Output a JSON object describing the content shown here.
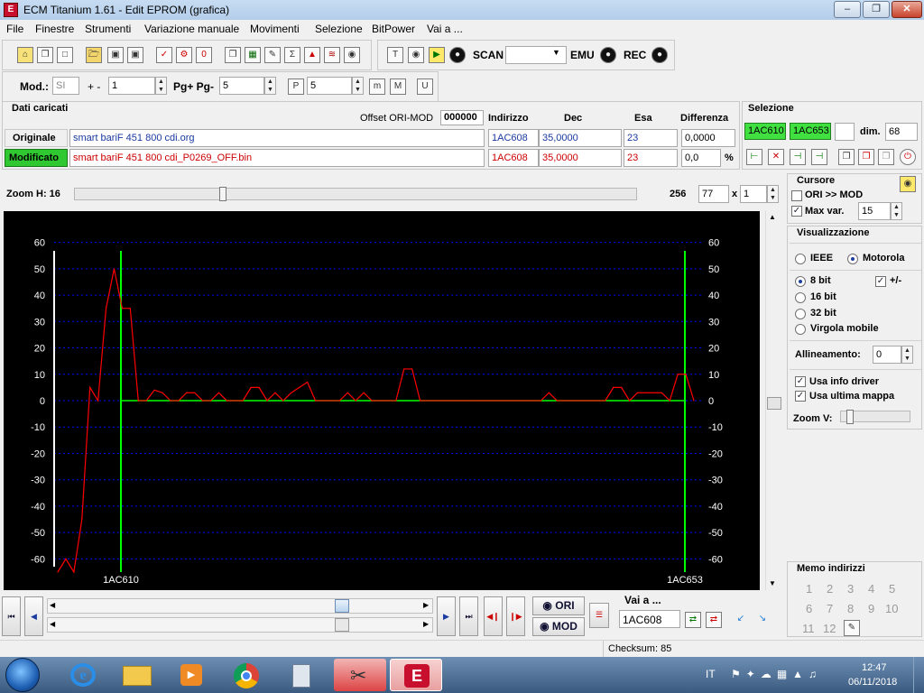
{
  "window": {
    "title": "ECM Titanium 1.61 - Edit EPROM (grafica)",
    "app_icon_letter": "E"
  },
  "menu": [
    "File",
    "Finestre",
    "Strumenti",
    "Variazione manuale",
    "Movimenti",
    "Selezione",
    "BitPower",
    "Vai a ..."
  ],
  "toolbar1": {
    "scan_label": "SCAN",
    "emu_label": "EMU",
    "rec_label": "REC",
    "scan_value": ""
  },
  "toolbar2": {
    "mod_label": "Mod.:",
    "mod_value": "SI",
    "plusminus_label": "+ -",
    "plusminus_value": "1",
    "pg_label": "Pg+ Pg-",
    "pg_value": "5",
    "p_value": "5"
  },
  "dati": {
    "title": "Dati caricati",
    "offset_label": "Offset ORI-MOD",
    "offset_value": "000000",
    "headers": {
      "indirizzo": "Indirizzo",
      "dec": "Dec",
      "esa": "Esa",
      "differenza": "Differenza"
    },
    "originale": {
      "label": "Originale",
      "file": "smart bariF 451 800 cdi.org",
      "indirizzo": "1AC608",
      "dec": "35,0000",
      "esa": "23",
      "differenza": "0,0000"
    },
    "modificato": {
      "label": "Modificato",
      "file": "smart bariF 451 800 cdi_P0269_OFF.bin",
      "indirizzo": "1AC608",
      "dec": "35,0000",
      "esa": "23",
      "differenza": "0,0",
      "percent": "%"
    }
  },
  "selezione": {
    "title": "Selezione",
    "start": "1AC610",
    "end": "1AC653",
    "dim_label": "dim.",
    "dim_value": "68"
  },
  "zoom": {
    "label": "Zoom H: 16",
    "value_256": "256",
    "value": "77",
    "x_label": "x",
    "x_value": "1",
    "slider_fraction": 0.26
  },
  "cursore": {
    "title": "Cursore",
    "ori_mod_label": "ORI >> MOD",
    "ori_mod_checked": false,
    "max_var_label": "Max var.",
    "max_var_checked": true,
    "max_var_value": "15"
  },
  "visualizzazione": {
    "title": "Visualizzazione",
    "ieee": "IEEE",
    "motorola": "Motorola",
    "selected_endian": "Motorola",
    "bit8": "8 bit",
    "bit16": "16 bit",
    "bit32": "32 bit",
    "virgola": "Virgola mobile",
    "selected_bits": "8 bit",
    "plusminus_label": "+/-",
    "plusminus_checked": true,
    "allineamento_label": "Allineamento:",
    "allineamento_value": "0",
    "usa_info_driver": "Usa info driver",
    "usa_ultima_mappa": "Usa ultima mappa",
    "zoomv_label": "Zoom V:"
  },
  "memo": {
    "title": "Memo indirizzi",
    "numbers": [
      "1",
      "2",
      "3",
      "4",
      "5",
      "6",
      "7",
      "8",
      "9",
      "10",
      "11",
      "12"
    ]
  },
  "bottom": {
    "ori_label": "ORI",
    "mod_label": "MOD",
    "vai_label": "Vai a ...",
    "vai_value": "1AC608",
    "checksum": "Checksum: 85",
    "hscroll_fraction": 0.8
  },
  "taskbar": {
    "lang": "IT",
    "time": "12:47",
    "date": "06/11/2018"
  },
  "colors": {
    "ori_line": "#ff0000",
    "mod_line": "#ff0000",
    "zero_line": "#00ff00",
    "marker": "#00ff00",
    "grid": "#0000ff",
    "green_box": "#40e040"
  },
  "chart_data": {
    "type": "line",
    "ylim": [
      -65,
      65
    ],
    "yticks": [
      60,
      50,
      40,
      30,
      20,
      10,
      0,
      -10,
      -20,
      -30,
      -40,
      -50,
      -60
    ],
    "marker_start": "1AC610",
    "marker_end": "1AC653",
    "x_range": [
      -15,
      77
    ],
    "series": [
      {
        "values": [
          -65,
          -60,
          -65,
          -45,
          5,
          0,
          35,
          50,
          35,
          35,
          0,
          0,
          4,
          3,
          0,
          0,
          3,
          3,
          0,
          0,
          3,
          0,
          0,
          0,
          5,
          5,
          0,
          3,
          0,
          3,
          5,
          7,
          0,
          0,
          0,
          0,
          3,
          0,
          3,
          0,
          0,
          0,
          0,
          12,
          12,
          0,
          0,
          0,
          0,
          0,
          0,
          0,
          0,
          0,
          0,
          0,
          0,
          0,
          0,
          0,
          0,
          3,
          0,
          0,
          0,
          0,
          0,
          0,
          0,
          5,
          5,
          0,
          3,
          3,
          3,
          3,
          0,
          10,
          10,
          0
        ]
      }
    ]
  }
}
